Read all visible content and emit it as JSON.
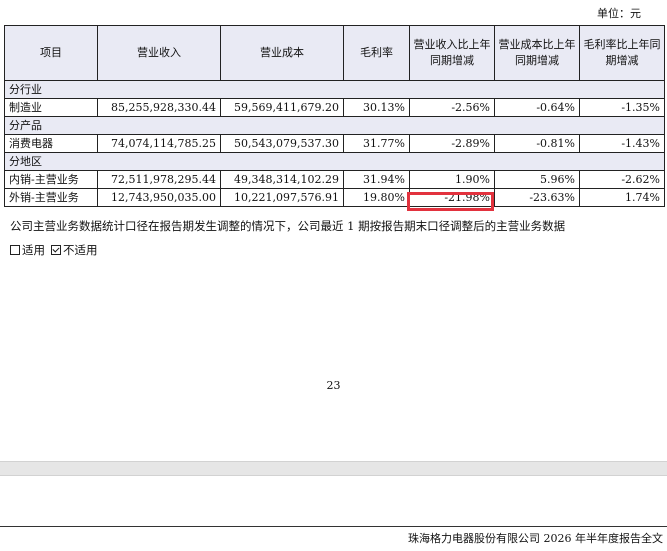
{
  "unit_label": "单位：元",
  "table": {
    "headers": [
      "项目",
      "营业收入",
      "营业成本",
      "毛利率",
      "营业收入比上年同期增减",
      "营业成本比上年同期增减",
      "毛利率比上年同期增减"
    ],
    "sections": [
      {
        "title": "分行业",
        "rows": [
          {
            "item": "制造业",
            "revenue": "85,255,928,330.44",
            "cost": "59,569,411,679.20",
            "gross_margin": "30.13%",
            "revenue_change": "-2.56%",
            "cost_change": "-0.64%",
            "margin_change": "-1.35%"
          }
        ]
      },
      {
        "title": "分产品",
        "rows": [
          {
            "item": "消费电器",
            "revenue": "74,074,114,785.25",
            "cost": "50,543,079,537.30",
            "gross_margin": "31.77%",
            "revenue_change": "-2.89%",
            "cost_change": "-0.81%",
            "margin_change": "-1.43%"
          }
        ]
      },
      {
        "title": "分地区",
        "rows": [
          {
            "item": "内销-主营业务",
            "revenue": "72,511,978,295.44",
            "cost": "49,348,314,102.29",
            "gross_margin": "31.94%",
            "revenue_change": "1.90%",
            "cost_change": "5.96%",
            "margin_change": "-2.62%"
          },
          {
            "item": "外销-主营业务",
            "revenue": "12,743,950,035.00",
            "cost": "10,221,097,576.91",
            "gross_margin": "19.80%",
            "revenue_change": "-21.98%",
            "cost_change": "-23.63%",
            "margin_change": "1.74%"
          }
        ]
      }
    ]
  },
  "highlight_color": "#e2323e",
  "note": "公司主营业务数据统计口径在报告期发生调整的情况下，公司最近 1 期按报告期末口径调整后的主营业务数据",
  "options": {
    "applicable": {
      "label": "适用",
      "checked": false
    },
    "not_applicable": {
      "label": "不适用",
      "checked": true
    }
  },
  "page_number": "23",
  "footer": "珠海格力电器股份有限公司 2026 年半年度报告全文"
}
